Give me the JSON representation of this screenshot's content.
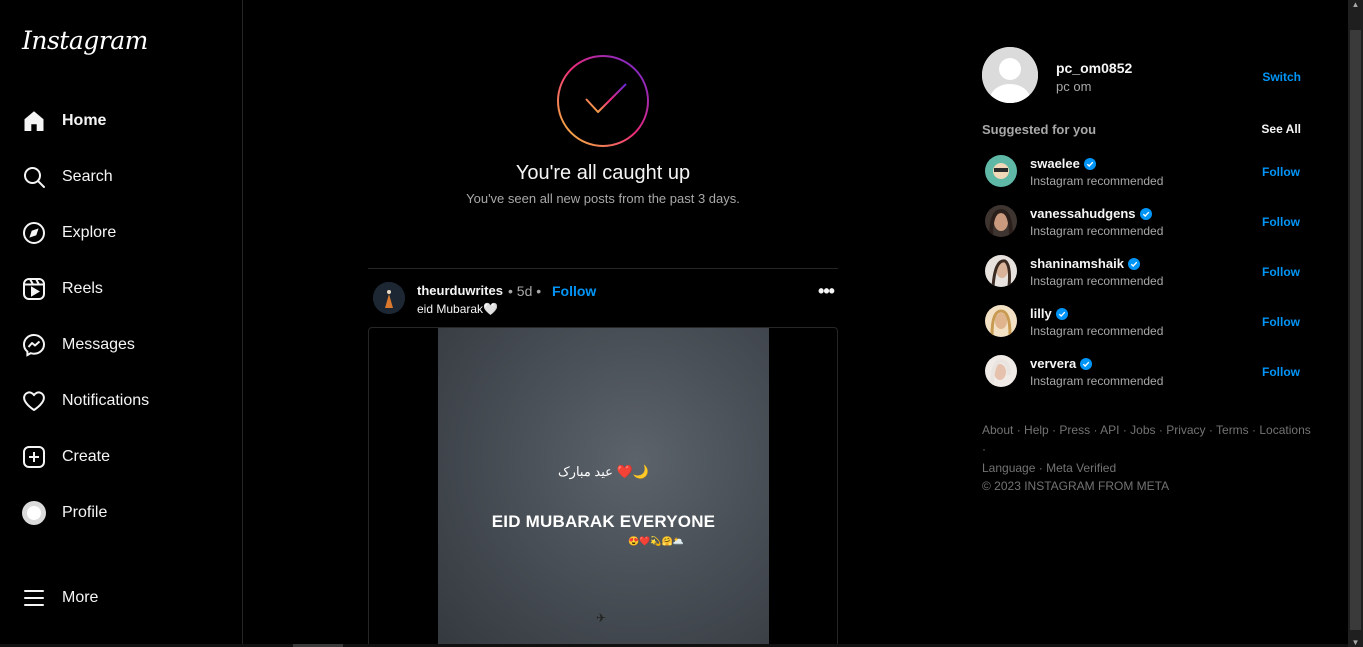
{
  "brand": {
    "logo_text": "Instagram"
  },
  "sidebar": {
    "items": [
      {
        "label": "Home",
        "icon": "home-icon",
        "active": true
      },
      {
        "label": "Search",
        "icon": "search-icon"
      },
      {
        "label": "Explore",
        "icon": "compass-icon"
      },
      {
        "label": "Reels",
        "icon": "reels-icon"
      },
      {
        "label": "Messages",
        "icon": "messenger-icon"
      },
      {
        "label": "Notifications",
        "icon": "heart-icon"
      },
      {
        "label": "Create",
        "icon": "plus-square-icon"
      },
      {
        "label": "Profile",
        "icon": "avatar-icon"
      }
    ],
    "more_label": "More"
  },
  "feed": {
    "caught_up": {
      "title": "You're all caught up",
      "subtitle": "You've seen all new posts from the past 3 days."
    },
    "post": {
      "username": "theurduwrites",
      "separator": "•",
      "age": "5d",
      "follow_label": "Follow",
      "caption": "eid Mubarak🤍",
      "image_text": {
        "urdu": "عید مبارک ❤️🌙",
        "title": "EID MUBARAK EVERYONE",
        "emojis": "😍❤️💫🤗🌥️"
      }
    }
  },
  "account": {
    "username": "pc_om0852",
    "name": "pc om",
    "switch_label": "Switch"
  },
  "suggestions": {
    "title": "Suggested for you",
    "see_all_label": "See All",
    "items": [
      {
        "username": "swaelee",
        "subtitle": "Instagram recommended",
        "follow_label": "Follow",
        "avatar_color": "#5fb8a6"
      },
      {
        "username": "vanessahudgens",
        "subtitle": "Instagram recommended",
        "follow_label": "Follow",
        "avatar_color": "#6e5a4e"
      },
      {
        "username": "shaninamshaik",
        "subtitle": "Instagram recommended",
        "follow_label": "Follow",
        "avatar_color": "#d9c8c0"
      },
      {
        "username": "lilly",
        "subtitle": "Instagram recommended",
        "follow_label": "Follow",
        "avatar_color": "#e8c9a0"
      },
      {
        "username": "ververa",
        "subtitle": "Instagram recommended",
        "follow_label": "Follow",
        "avatar_color": "#e6d7cf"
      }
    ]
  },
  "footer": {
    "links": [
      "About",
      "Help",
      "Press",
      "API",
      "Jobs",
      "Privacy",
      "Terms",
      "Locations",
      "Language",
      "Meta Verified"
    ],
    "separator": "·",
    "copyright": "© 2023 INSTAGRAM FROM META"
  },
  "colors": {
    "background": "#000000",
    "accent_blue": "#0095f6",
    "muted_text": "#a8a8a8",
    "divider": "#262626"
  }
}
